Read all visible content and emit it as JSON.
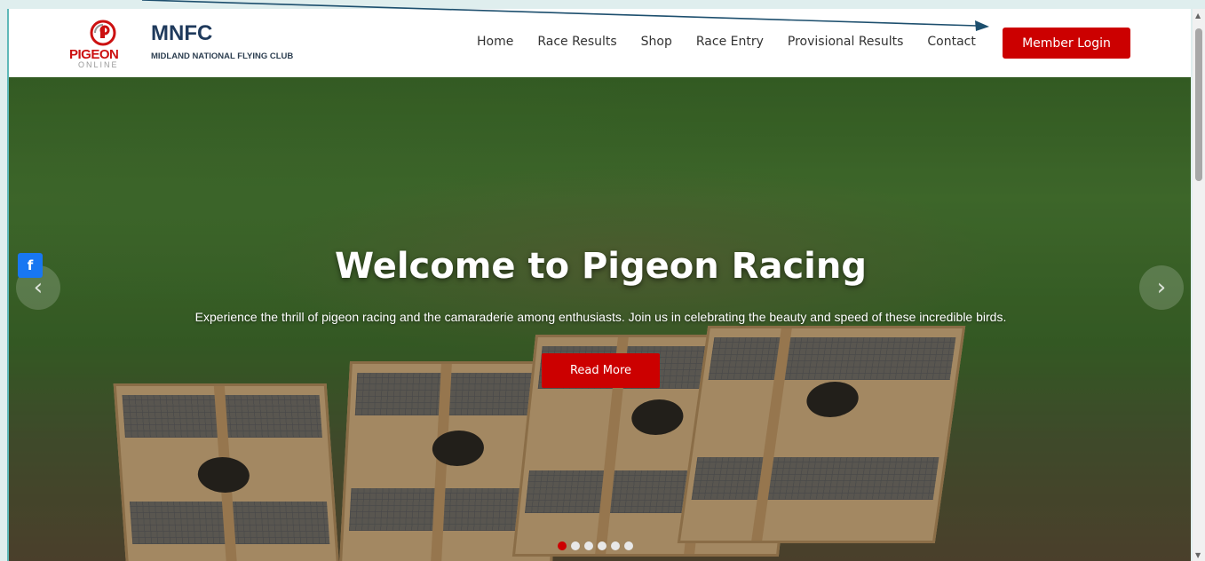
{
  "brand": {
    "logo_word": "PIGEON",
    "logo_sub": "ONLINE",
    "name": "MNFC",
    "subtitle": "MIDLAND NATIONAL FLYING CLUB"
  },
  "nav": {
    "items": [
      "Home",
      "Race Results",
      "Shop",
      "Race Entry",
      "Provisional Results",
      "Contact"
    ],
    "login_label": "Member Login"
  },
  "hero": {
    "title": "Welcome to Pigeon Racing",
    "text": "Experience the thrill of pigeon racing and the camaraderie among enthusiasts. Join us in celebrating the beauty and speed of these incredible birds.",
    "cta_label": "Read More",
    "slide_count": 6,
    "active_slide": 1
  },
  "social": {
    "facebook_glyph": "f"
  },
  "colors": {
    "accent": "#cc0000",
    "brand_navy": "#1f3a5c",
    "facebook": "#1877f2"
  },
  "icons": [
    "pigeon-online-logo",
    "facebook-icon",
    "chevron-left-icon",
    "chevron-right-icon",
    "scroll-up-icon",
    "scroll-down-icon"
  ]
}
